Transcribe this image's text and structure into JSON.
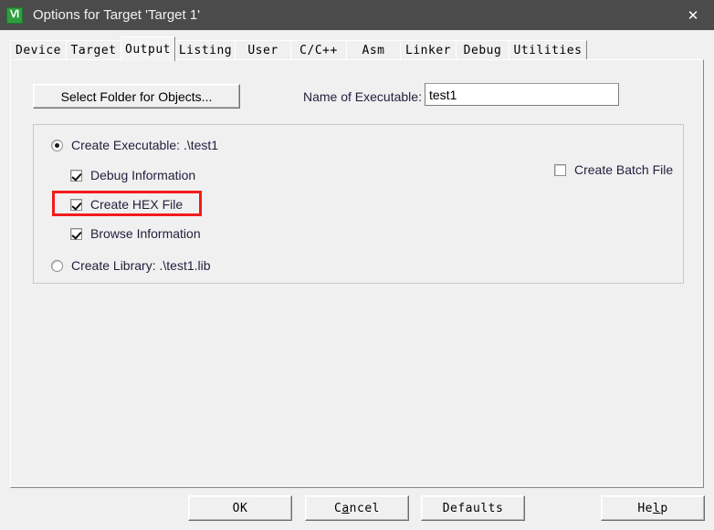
{
  "window": {
    "title": "Options for Target 'Target 1'",
    "icon": "keil-uvision-icon",
    "icon_glyph": "Ⅵ",
    "close_label": "✕",
    "titlebar_color": "#4b4b4b",
    "face_color": "#f0f0f0"
  },
  "tabs": [
    {
      "label": "Device",
      "active": false
    },
    {
      "label": "Target",
      "active": false
    },
    {
      "label": "Output",
      "active": true
    },
    {
      "label": "Listing",
      "active": false
    },
    {
      "label": "User",
      "active": false
    },
    {
      "label": "C/C++",
      "active": false
    },
    {
      "label": "Asm",
      "active": false
    },
    {
      "label": "Linker",
      "active": false
    },
    {
      "label": "Debug",
      "active": false
    },
    {
      "label": "Utilities",
      "active": false
    }
  ],
  "output_tab": {
    "select_folder_button": "Select Folder for Objects...",
    "executable_name_label": "Name of Executable:",
    "executable_name_value": "test1",
    "executable_name_placeholder": "",
    "create_executable": {
      "label": "Create Executable:  .\\test1",
      "checked": true
    },
    "debug_information": {
      "label": "Debug Information",
      "checked": true
    },
    "create_hex_file": {
      "label": "Create HEX File",
      "checked": true,
      "highlight_color": "#f31b1b"
    },
    "browse_information": {
      "label": "Browse Information",
      "checked": true
    },
    "create_library": {
      "label": "Create Library:  .\\test1.lib",
      "checked": false
    },
    "create_batch_file": {
      "label": "Create Batch File",
      "checked": false
    }
  },
  "footer": {
    "ok": "OK",
    "cancel_prefix": "C",
    "cancel_accel": "a",
    "cancel_suffix": "ncel",
    "cancel": "Cancel",
    "defaults": "Defaults",
    "help_prefix": "He",
    "help_accel": "l",
    "help_suffix": "p",
    "help": "Help"
  }
}
